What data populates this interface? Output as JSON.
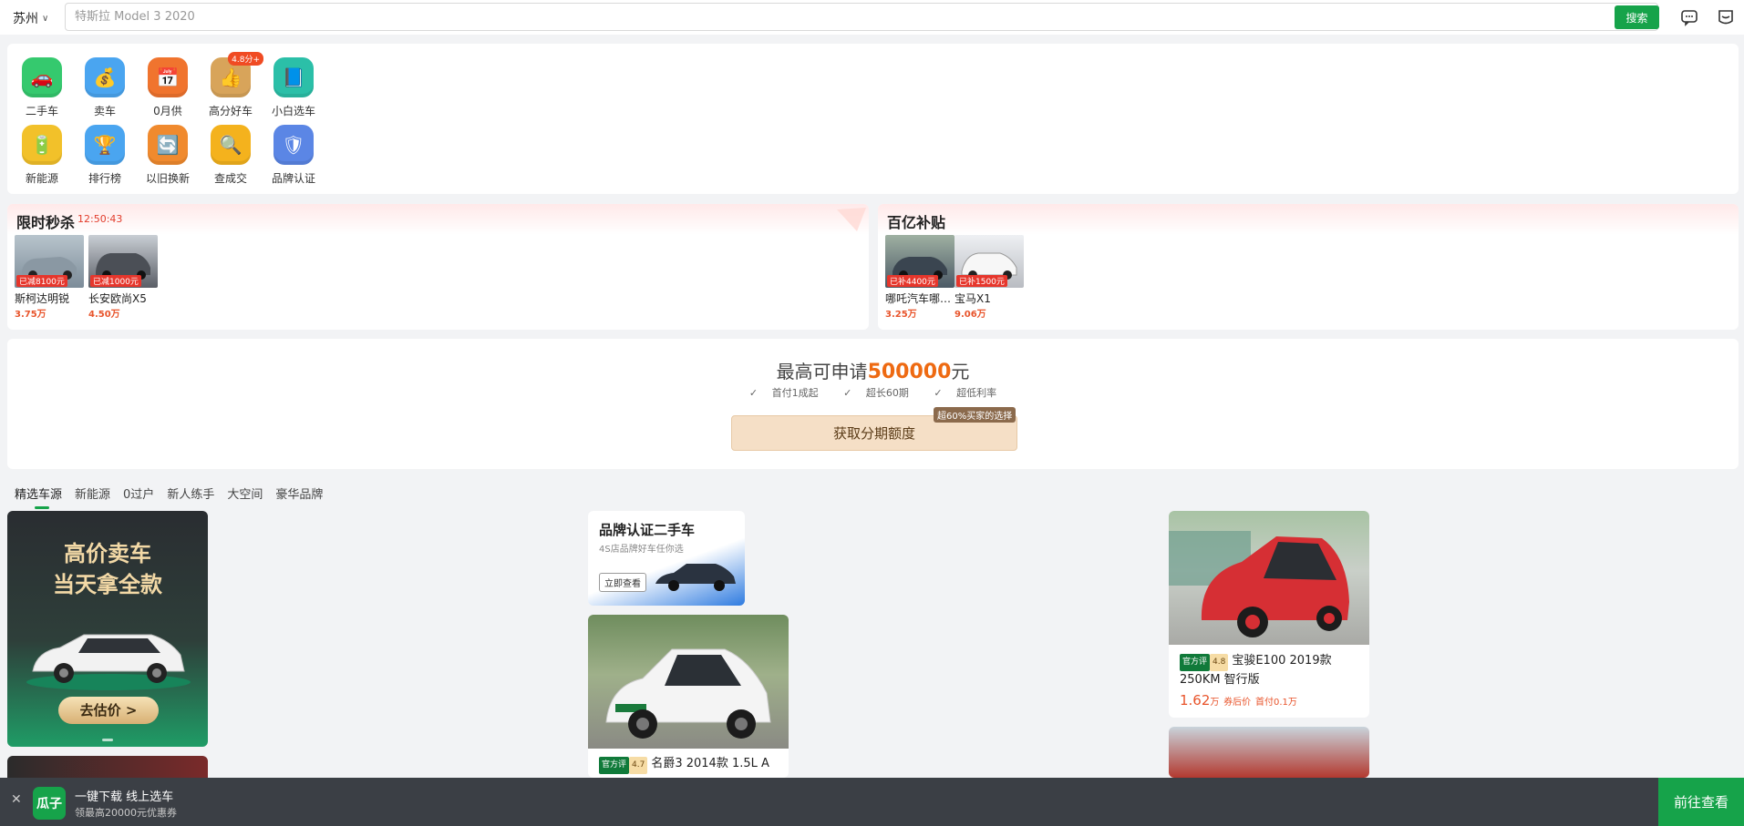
{
  "header": {
    "city": "苏州",
    "search_placeholder": "特斯拉 Model 3 2020",
    "search_button": "搜索"
  },
  "quick_entries": [
    {
      "label": "二手车",
      "color": "#35c96e",
      "icon": "car-icon"
    },
    {
      "label": "卖车",
      "color": "#4aa5f0",
      "icon": "coins-icon"
    },
    {
      "label": "0月供",
      "color": "#f0742e",
      "icon": "calendar-icon"
    },
    {
      "label": "高分好车",
      "color": "#d8a45a",
      "icon": "thumb-up-icon",
      "badge": "4.8分+"
    },
    {
      "label": "小白选车",
      "color": "#2bbfa8",
      "icon": "book-icon"
    },
    {
      "label": "新能源",
      "color": "#f2c12a",
      "icon": "battery-icon"
    },
    {
      "label": "排行榜",
      "color": "#4aa5f0",
      "icon": "trophy-icon"
    },
    {
      "label": "以旧换新",
      "color": "#f08a2e",
      "icon": "swap-icon"
    },
    {
      "label": "查成交",
      "color": "#f4b21d",
      "icon": "magnifier-icon"
    },
    {
      "label": "品牌认证",
      "color": "#5b86e5",
      "icon": "shield-icon"
    }
  ],
  "flash_sale": {
    "title": "限时秒杀",
    "timer": "12:50:43",
    "items": [
      {
        "name": "斯柯达明锐",
        "price": "3.75万",
        "tag": "已减8100元",
        "color": "#7c8c99"
      },
      {
        "name": "长安欧尚X5",
        "price": "4.50万",
        "tag": "已减1000元",
        "color": "#5a5e66"
      }
    ]
  },
  "subsidy": {
    "title": "百亿补贴",
    "items": [
      {
        "name": "哪吒汽车哪吒V",
        "price": "3.25万",
        "tag": "已补4400元",
        "color": "#4c5a66"
      },
      {
        "name": "宝马X1",
        "price": "9.06万",
        "tag": "已补1500元",
        "color": "#d9dbe0"
      }
    ]
  },
  "loan": {
    "title_prefix": "最高可申请",
    "amount": "500000",
    "title_suffix": "元",
    "features": [
      "首付1成起",
      "超长60期",
      "超低利率"
    ],
    "button": "获取分期额度",
    "button_tag": "超60%买家的选择"
  },
  "tabs": [
    "精选车源",
    "新能源",
    "0过户",
    "新人练手",
    "大空间",
    "豪华品牌"
  ],
  "banners": {
    "sell": {
      "line1": "高价卖车",
      "line2": "当天拿全款",
      "button": "去估价 >"
    },
    "brand": {
      "title": "品牌认证二手车",
      "subtitle": "4S店品牌好车任你选",
      "button": "立即查看"
    }
  },
  "listings": [
    {
      "title": "名爵3 2014款 1.5L A",
      "score": "4.7",
      "official": "官方评"
    },
    {
      "title": "宝骏E100 2019款 250KM 智行版",
      "score": "4.8",
      "official": "官方评",
      "price": "1.62",
      "unit": "万",
      "price_note": "券后价",
      "down": "首付0.1万"
    }
  ],
  "bottom_bar": {
    "logo": "瓜子",
    "line1": "一键下载 线上选车",
    "line2": "领最高20000元优惠券",
    "button": "前往查看"
  }
}
